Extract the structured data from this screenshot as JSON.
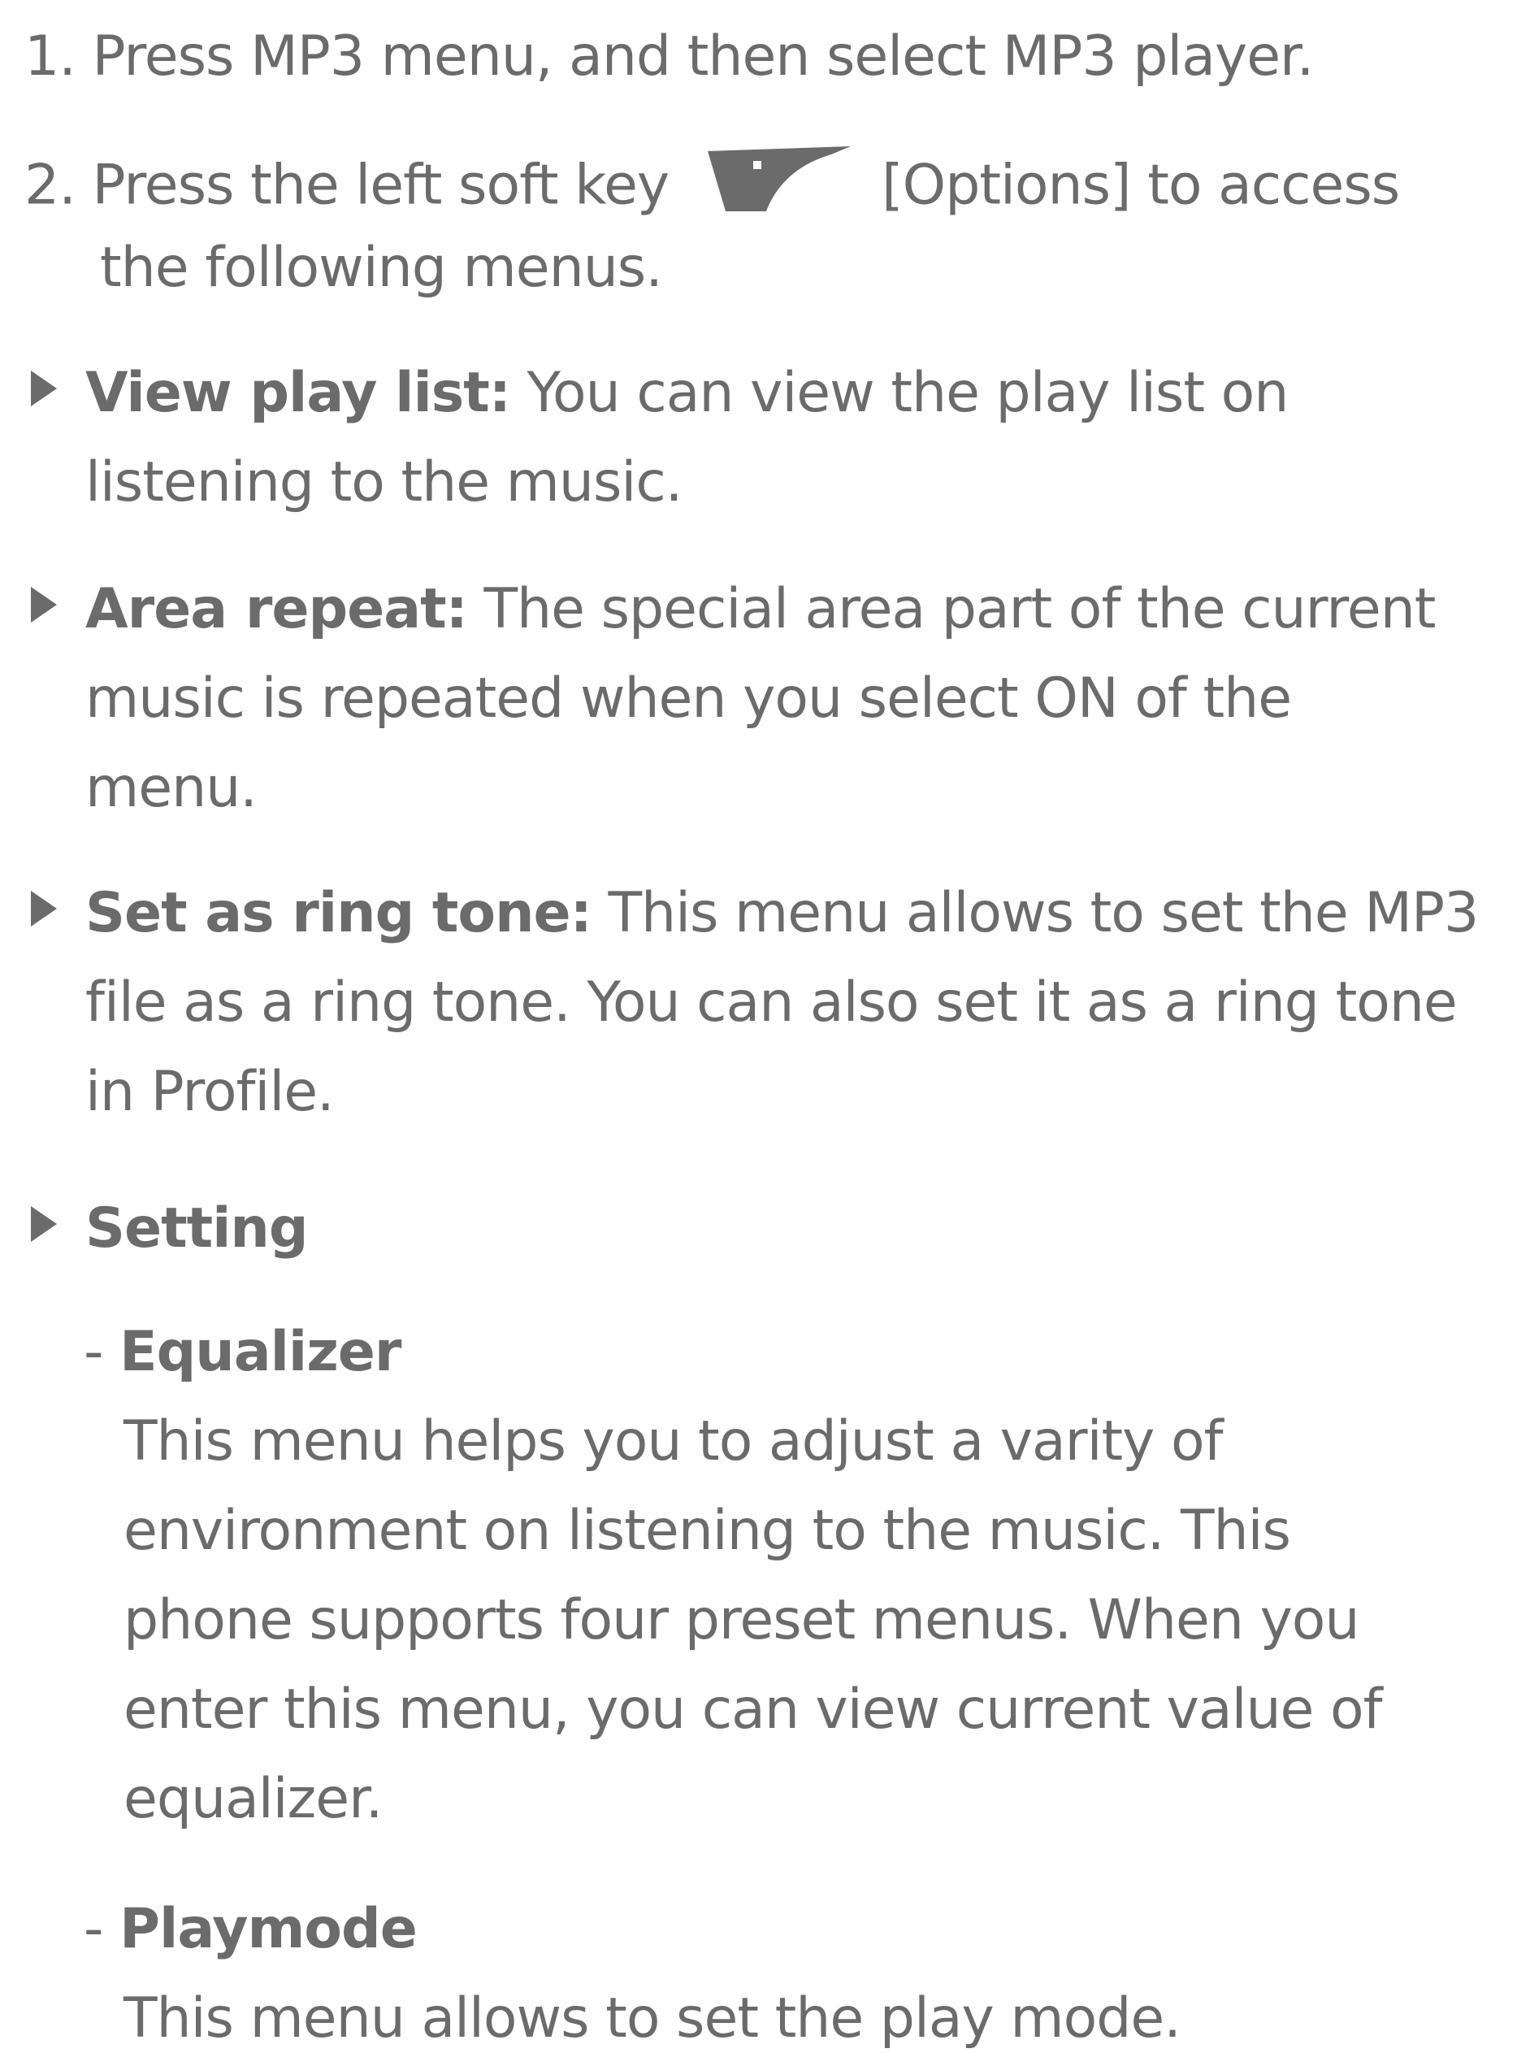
{
  "steps": [
    {
      "num": "1.",
      "text": "Press MP3 menu, and then select MP3 player."
    },
    {
      "num": "2.",
      "text_before": "Press the left soft key",
      "icon": "left-soft-key-icon",
      "text_after": "[Options] to access",
      "continuation": "the following menus."
    }
  ],
  "items": [
    {
      "term": "View play list:",
      "lines": [
        " You can view the play list on",
        "listening to the music."
      ]
    },
    {
      "term": "Area repeat:",
      "lines": [
        " The special area part of the current",
        "music is repeated when you select ON of the",
        "menu."
      ]
    },
    {
      "term": "Set as ring tone:",
      "lines": [
        " This menu allows to set the MP3",
        "file as a ring tone. You can also set it as a ring tone",
        "in Profile."
      ]
    },
    {
      "term": "Setting"
    }
  ],
  "subitems": [
    {
      "dash": "-",
      "term": "Equalizer",
      "lines": [
        "This menu helps you to adjust a varity of",
        "environment on listening to the music. This",
        "phone supports four preset menus. When you",
        "enter this menu, you can view current value of",
        "equalizer."
      ]
    },
    {
      "dash": "-",
      "term": "Playmode",
      "lines": [
        "This menu allows to set the play mode."
      ]
    }
  ],
  "colors": {
    "text": "#6b6b6b",
    "icon": "#6b6b6b"
  }
}
